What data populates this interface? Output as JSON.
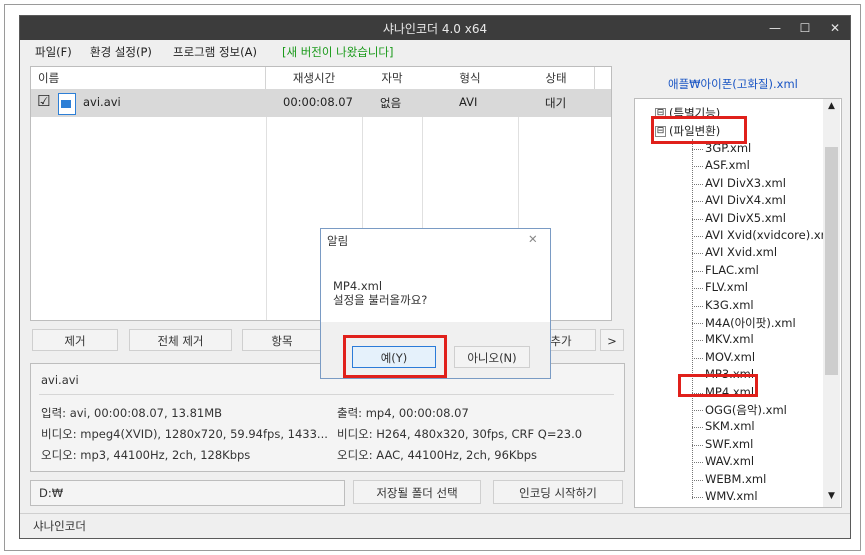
{
  "window": {
    "title": "샤나인코더 4.0 x64",
    "minimize": "—",
    "maximize": "☐",
    "close": "✕"
  },
  "menu": [
    "파일(F)",
    "환경 설정(P)",
    "프로그램 정보(A)",
    "[새 버전이 나왔습니다]"
  ],
  "table": {
    "headers": [
      "이름",
      "재생시간",
      "자막",
      "형식",
      "상태"
    ],
    "rows": [
      {
        "checked": "☑",
        "name": "avi.avi",
        "duration": "00:00:08.07",
        "subtitle": "없음",
        "format": "AVI",
        "status": "대기"
      }
    ]
  },
  "buttons": {
    "remove": "제거",
    "remove_all": "전체 제거",
    "item": "항목",
    "add": "추가",
    "more": ">"
  },
  "file_info": {
    "filename": "avi.avi",
    "input": "입력: avi, 00:00:08.07, 13.81MB",
    "input_video": "비디오: mpeg4(XVID), 1280x720, 59.94fps, 1433...",
    "input_audio": "오디오: mp3, 44100Hz, 2ch, 128Kbps",
    "output": "출력: mp4, 00:00:08.07",
    "output_video": "비디오: H264, 480x320, 30fps, CRF Q=23.0",
    "output_audio": "오디오: AAC, 44100Hz, 2ch, 96Kbps"
  },
  "bottom": {
    "folder": "D:₩",
    "select_folder": "저장될 폴더 선택",
    "start_encoding": "인코딩 시작하기"
  },
  "status_bar": "샤나인코더",
  "preset_path": "애플₩아이폰(고화질).xml",
  "tree": {
    "root1": "(특별기능)",
    "root2": "(파일변환)",
    "items": [
      "3GP.xml",
      "ASF.xml",
      "AVI DivX3.xml",
      "AVI DivX4.xml",
      "AVI DivX5.xml",
      "AVI Xvid(xvidcore).xml",
      "AVI Xvid.xml",
      "FLAC.xml",
      "FLV.xml",
      "K3G.xml",
      "M4A(아이팟).xml",
      "MKV.xml",
      "MOV.xml",
      "MP3.xml",
      "MP4.xml",
      "OGG(음악).xml",
      "SKM.xml",
      "SWF.xml",
      "WAV.xml",
      "WEBM.xml",
      "WMV.xml"
    ]
  },
  "dialog": {
    "title": "알림",
    "close": "✕",
    "line1": "MP4.xml",
    "line2": "설정을 불러올까요?",
    "yes": "예(Y)",
    "no": "아니오(N)"
  },
  "colors": {
    "highlight": "#e0201b",
    "titlebar": "#3c3c3c",
    "new_version": "#1a9a1a",
    "preset_link": "#1b56c4"
  }
}
